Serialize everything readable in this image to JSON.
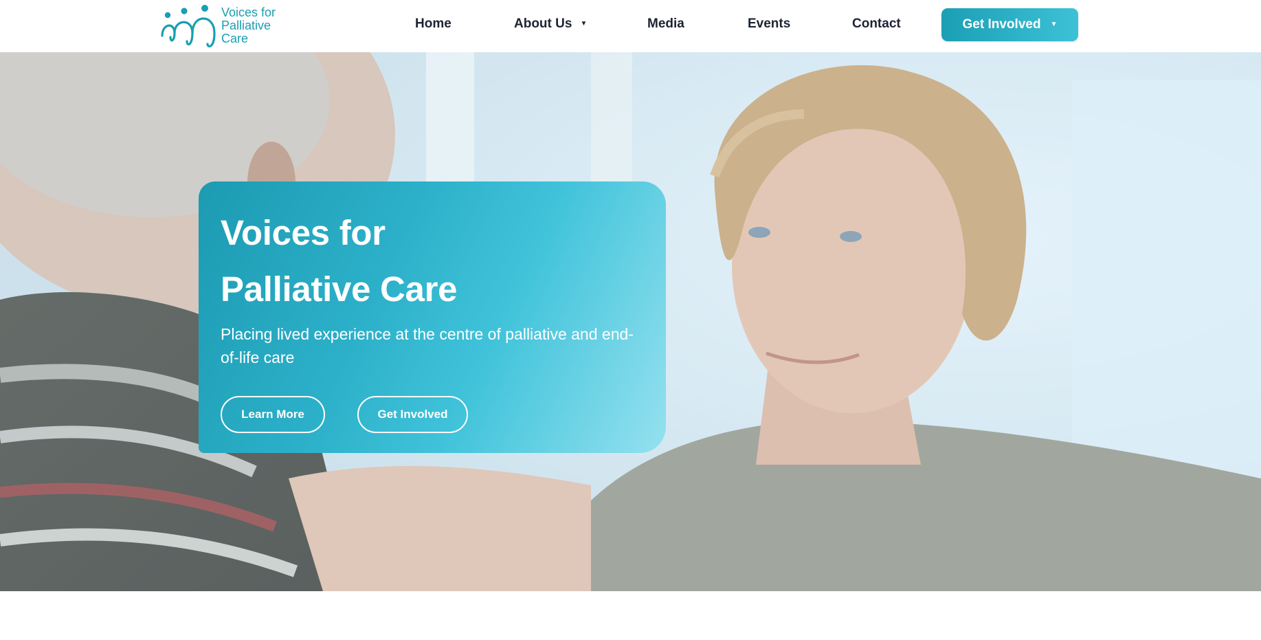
{
  "brand": {
    "name_line1": "Voices for",
    "name_line2": "Palliative",
    "name_line3": "Care",
    "logo_icon": "three-figures-logo",
    "color_primary": "#1a9eb1",
    "color_accent": "#3cc1d7"
  },
  "nav": {
    "items": [
      {
        "label": "Home"
      },
      {
        "label": "About Us",
        "has_dropdown": true
      },
      {
        "label": "Media"
      },
      {
        "label": "Events"
      },
      {
        "label": "Contact"
      }
    ],
    "cta": {
      "label": "Get Involved",
      "has_dropdown": true
    }
  },
  "hero": {
    "title_line1": "Voices for",
    "title_line2": "Palliative Care",
    "subtitle": "Placing lived experience at the centre of palliative and end-of-life care",
    "buttons": {
      "learn_more": "Learn More",
      "get_involved": "Get Involved"
    },
    "image_description_icon": "hero-photo"
  },
  "icons": {
    "dropdown": "caret-down-icon"
  }
}
